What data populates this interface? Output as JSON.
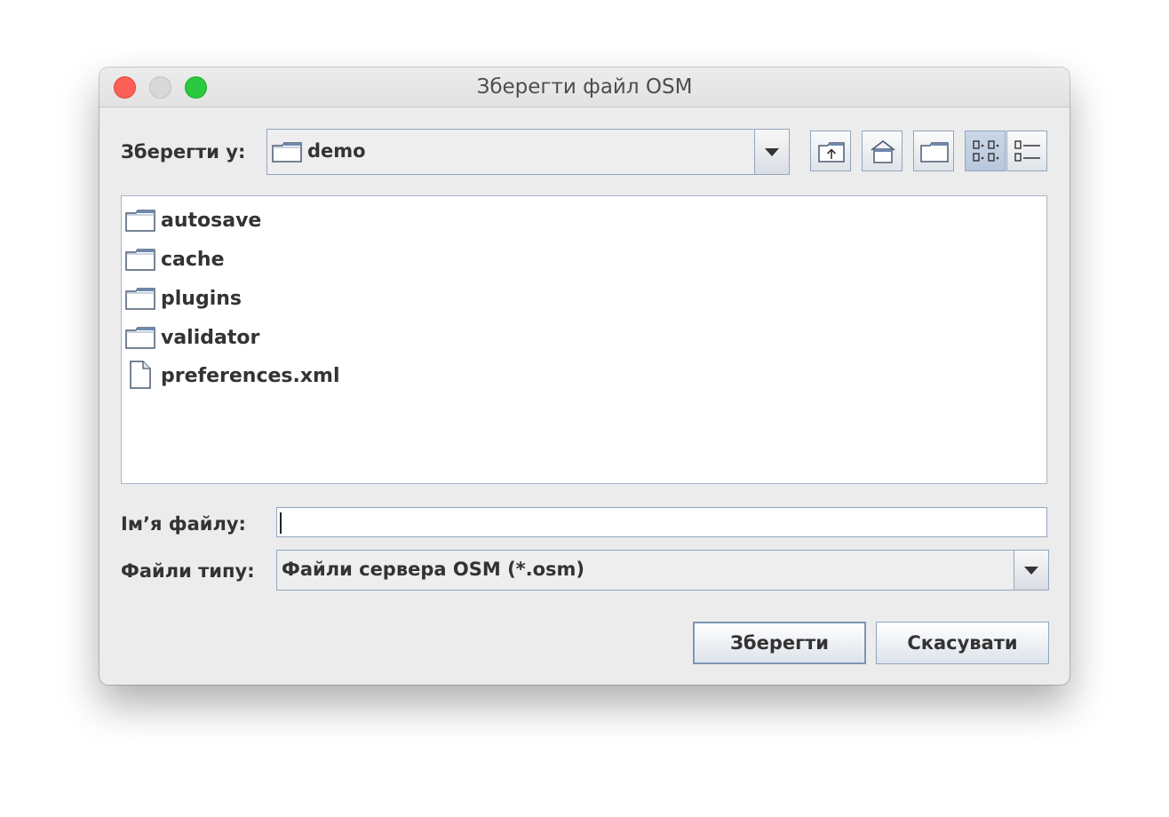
{
  "window": {
    "title": "Зберегти файл OSM"
  },
  "save_in": {
    "label": "Зберегти у:",
    "current_folder": "demo"
  },
  "toolbar": {
    "icons": [
      "up-folder-icon",
      "home-icon",
      "new-folder-icon",
      "list-view-icon",
      "details-view-icon"
    ],
    "active_view": "list"
  },
  "files": [
    {
      "name": "autosave",
      "type": "folder"
    },
    {
      "name": "cache",
      "type": "folder"
    },
    {
      "name": "plugins",
      "type": "folder"
    },
    {
      "name": "validator",
      "type": "folder"
    },
    {
      "name": "preferences.xml",
      "type": "file"
    }
  ],
  "filename": {
    "label": "Ім’я файлу:",
    "value": ""
  },
  "filetype": {
    "label": "Файли типу:",
    "selected": "Файли сервера OSM (*.osm)"
  },
  "buttons": {
    "save": "Зберегти",
    "cancel": "Скасувати"
  },
  "colors": {
    "close": "#fe5f57",
    "minimize": "#d8d8d8",
    "maximize": "#29c940",
    "accent_border": "#93a6bd"
  }
}
